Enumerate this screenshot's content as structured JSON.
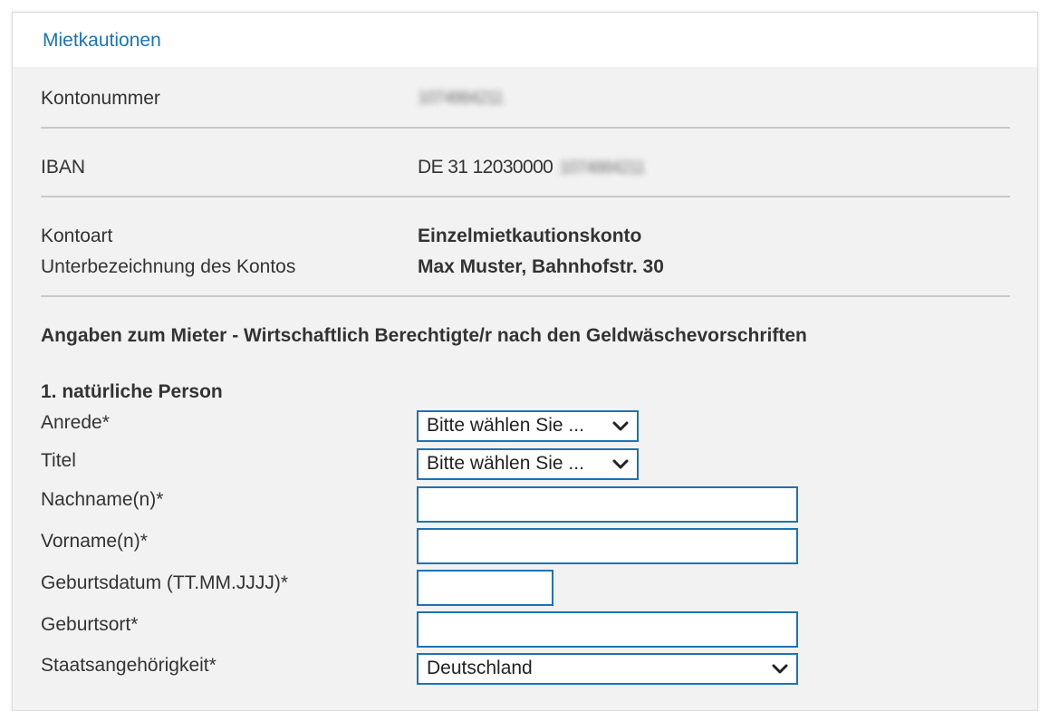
{
  "panel": {
    "title": "Mietkautionen"
  },
  "account": {
    "kontonummer_label": "Kontonummer",
    "kontonummer_value": "1074884211",
    "iban_label": "IBAN",
    "iban_prefix": "DE 31 12030000",
    "iban_masked": "1074884211",
    "kontoart_label": "Kontoart",
    "kontoart_value": "Einzelmietkautionskonto",
    "unterbezeichnung_label": "Unterbezeichnung des Kontos",
    "unterbezeichnung_value": "Max Muster, Bahnhofstr. 30"
  },
  "section": {
    "heading": "Angaben zum Mieter - Wirtschaftlich Berechtigte/r nach den Geldwäschevorschriften",
    "person_heading": "1. natürliche Person"
  },
  "form": {
    "anrede_label": "Anrede*",
    "anrede_value": "Bitte wählen Sie ...",
    "titel_label": "Titel",
    "titel_value": "Bitte wählen Sie ...",
    "nachname_label": "Nachname(n)*",
    "nachname_value": "",
    "vorname_label": "Vorname(n)*",
    "vorname_value": "",
    "geburtsdatum_label": "Geburtsdatum (TT.MM.JJJJ)*",
    "geburtsdatum_value": "",
    "geburtsort_label": "Geburtsort*",
    "geburtsort_value": "",
    "staatsangehoerigkeit_label": "Staatsangehörigkeit*",
    "staatsangehoerigkeit_value": "Deutschland"
  },
  "icons": {
    "dropdown": "chevron-down-icon"
  },
  "colors": {
    "accent": "#1a73b5",
    "panel_bg": "#f2f2f2",
    "divider": "#c9c9c9"
  }
}
